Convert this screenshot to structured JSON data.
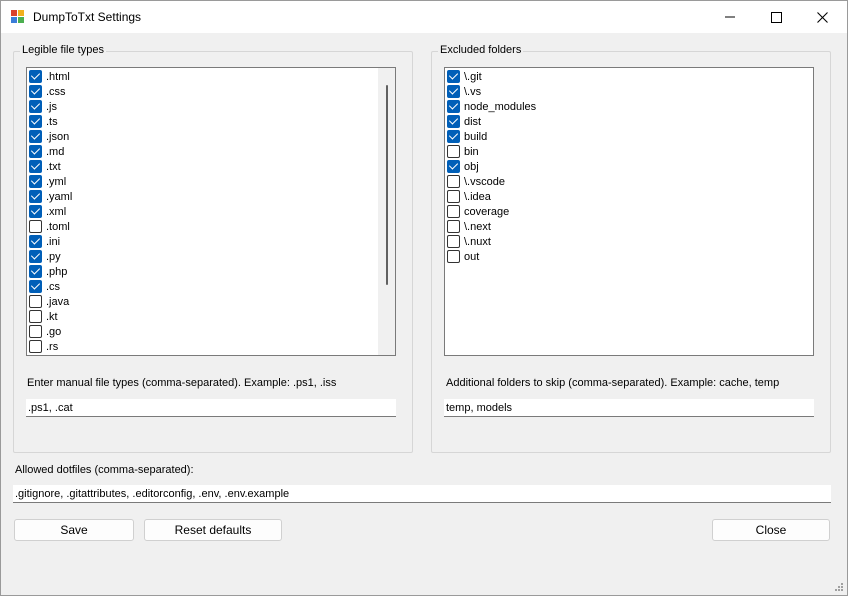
{
  "window": {
    "title": "DumpToTxt Settings",
    "icons": {
      "app": "app-icon",
      "minimize": "minimize-icon",
      "maximize": "maximize-icon",
      "close": "close-icon",
      "resize": "resize-grip-icon"
    }
  },
  "file_types": {
    "legend": "Legible file types",
    "items": [
      {
        "label": ".html",
        "checked": true
      },
      {
        "label": ".css",
        "checked": true
      },
      {
        "label": ".js",
        "checked": true
      },
      {
        "label": ".ts",
        "checked": true
      },
      {
        "label": ".json",
        "checked": true
      },
      {
        "label": ".md",
        "checked": true
      },
      {
        "label": ".txt",
        "checked": true
      },
      {
        "label": ".yml",
        "checked": true
      },
      {
        "label": ".yaml",
        "checked": true
      },
      {
        "label": ".xml",
        "checked": true
      },
      {
        "label": ".toml",
        "checked": false
      },
      {
        "label": ".ini",
        "checked": true
      },
      {
        "label": ".py",
        "checked": true
      },
      {
        "label": ".php",
        "checked": true
      },
      {
        "label": ".cs",
        "checked": true
      },
      {
        "label": ".java",
        "checked": false
      },
      {
        "label": ".kt",
        "checked": false
      },
      {
        "label": ".go",
        "checked": false
      },
      {
        "label": ".rs",
        "checked": false
      }
    ],
    "manual_label": "Enter manual file types (comma-separated). Example: .ps1, .iss",
    "manual_value": ".ps1, .cat"
  },
  "excluded_folders": {
    "legend": "Excluded folders",
    "items": [
      {
        "label": "\\.git",
        "checked": true
      },
      {
        "label": "\\.vs",
        "checked": true
      },
      {
        "label": "node_modules",
        "checked": true
      },
      {
        "label": "dist",
        "checked": true
      },
      {
        "label": "build",
        "checked": true
      },
      {
        "label": "bin",
        "checked": false
      },
      {
        "label": "obj",
        "checked": true
      },
      {
        "label": "\\.vscode",
        "checked": false
      },
      {
        "label": "\\.idea",
        "checked": false
      },
      {
        "label": "coverage",
        "checked": false
      },
      {
        "label": "\\.next",
        "checked": false
      },
      {
        "label": "\\.nuxt",
        "checked": false
      },
      {
        "label": "out",
        "checked": false
      }
    ],
    "additional_label": "Additional folders to skip (comma-separated). Example: cache, temp",
    "additional_value": "temp, models"
  },
  "dotfiles": {
    "label": "Allowed dotfiles (comma-separated):",
    "value": ".gitignore, .gitattributes, .editorconfig, .env, .env.example"
  },
  "buttons": {
    "save": "Save",
    "reset": "Reset defaults",
    "close": "Close"
  },
  "colors": {
    "accent": "#005fb8",
    "window_bg": "#f0f0f0",
    "titlebar_bg": "#ffffff"
  }
}
